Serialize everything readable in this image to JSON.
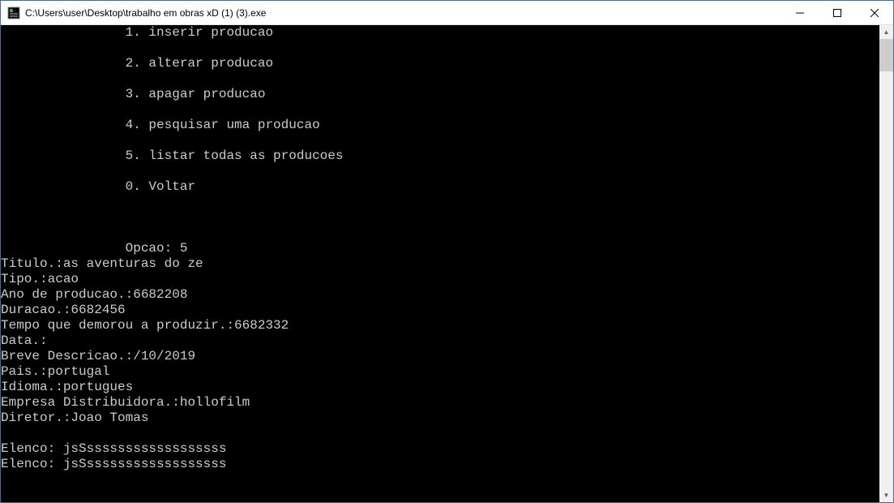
{
  "window": {
    "title": "C:\\Users\\user\\Desktop\\trabalho em obras xD (1) (3).exe"
  },
  "menu": {
    "indent": "                ",
    "item1": "1. inserir producao",
    "item2": "2. alterar producao",
    "item3": "3. apagar producao",
    "item4": "4. pesquisar uma producao",
    "item5": "5. listar todas as producoes",
    "item0": "0. Voltar",
    "prompt": "Opcao: 5"
  },
  "output": {
    "titulo": "Titulo.:as aventuras do ze",
    "tipo": "Tipo.:acao",
    "ano": "Ano de producao.:6682208",
    "duracao": "Duracao.:6682456",
    "tempo": "Tempo que demorou a produzir.:6682332",
    "data": "Data.:\u0007",
    "descricao": "Breve Descricao.:/10/2019",
    "pais": "Pais.:portugal",
    "idioma": "Idioma.:portugues",
    "empresa": "Empresa Distribuidora.:hollofilm",
    "diretor": "Diretor.:Joao Tomas",
    "elenco1": "Elenco: jsSssssssssssssssssss",
    "elenco2": "Elenco: jsSssssssssssssssssss"
  }
}
